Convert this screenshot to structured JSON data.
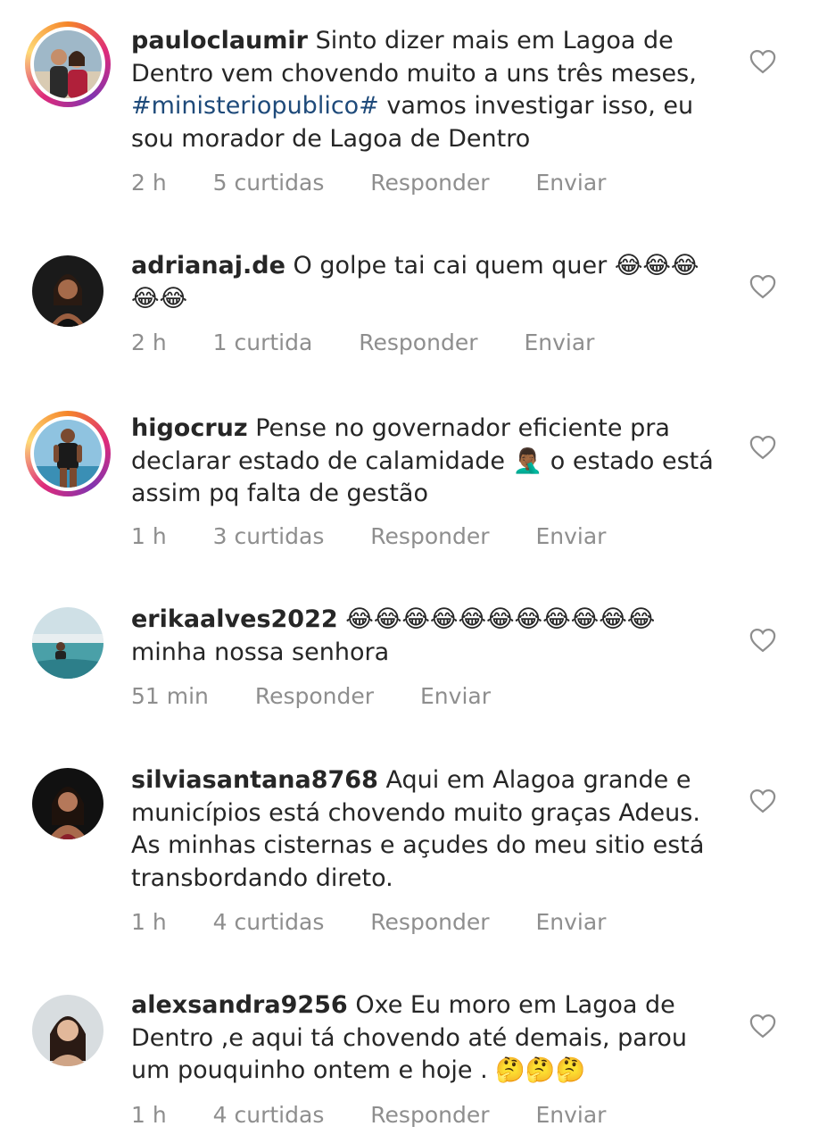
{
  "comments": [
    {
      "username": "pauloclaumir",
      "text_parts": [
        "Sinto dizer mais em Lagoa de Dentro vem chovendo muito a uns três meses, ",
        "#ministeriopublico#",
        " vamos investigar isso, eu sou morador de Lagoa de Dentro"
      ],
      "time": "2 h",
      "likes": "5 curtidas",
      "reply": "Responder",
      "send": "Enviar",
      "avatar_icon": "user-avatar-couple"
    },
    {
      "username": "adrianaj.de",
      "text": "O golpe tai cai quem quer 😂😂😂 😂😂",
      "time": "2 h",
      "likes": "1 curtida",
      "reply": "Responder",
      "send": "Enviar",
      "avatar_icon": "user-avatar-woman"
    },
    {
      "username": "higocruz",
      "text": "Pense no governador eficiente pra declarar estado de calamidade 🤦🏾‍♂️ o estado está assim pq falta de gestão",
      "time": "1 h",
      "likes": "3 curtidas",
      "reply": "Responder",
      "send": "Enviar",
      "avatar_icon": "user-avatar-man"
    },
    {
      "username": "erikaalves2022",
      "text": "😂😂😂😂😂😂😂😂😂😂😂 minha nossa senhora",
      "time": "51 min",
      "reply": "Responder",
      "send": "Enviar",
      "avatar_icon": "user-avatar-pool"
    },
    {
      "username": "silviasantana8768",
      "text": "Aqui em Alagoa grande e municípios está chovendo muito graças Adeus. As minhas cisternas e açudes do meu sitio está transbordando  direto.",
      "time": "1 h",
      "likes": "4 curtidas",
      "reply": "Responder",
      "send": "Enviar",
      "avatar_icon": "user-avatar-woman"
    },
    {
      "username": "alexsandra9256",
      "text": "Oxe Eu moro em Lagoa de Dentro ,e aqui tá chovendo até demais, parou um pouquinho ontem e hoje . 🤔🤔🤔",
      "time": "1 h",
      "likes": "4 curtidas",
      "reply": "Responder",
      "send": "Enviar",
      "avatar_icon": "user-avatar-woman"
    }
  ],
  "colors": {
    "text": "#262626",
    "meta": "#8e8e8e",
    "hashtag": "#1e4a7a",
    "story_ring": "#dd2a7b"
  }
}
